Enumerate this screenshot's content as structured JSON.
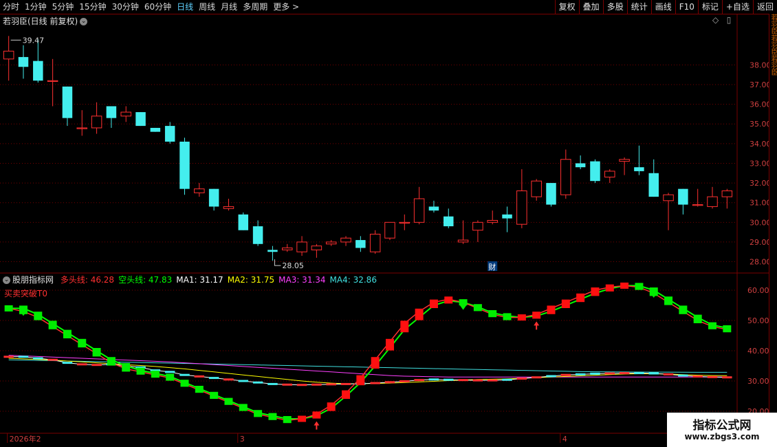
{
  "toolbar": {
    "periods": [
      "分时",
      "1分钟",
      "5分钟",
      "15分钟",
      "30分钟",
      "60分钟",
      "日线",
      "周线",
      "月线",
      "多周期",
      "更多 >"
    ],
    "active_period": "日线",
    "buttons": [
      "复权",
      "叠加",
      "多股",
      "统计",
      "画线",
      "F10",
      "标记",
      "+自选",
      "返回"
    ]
  },
  "stock": {
    "title": "若羽臣(日线 前复权)"
  },
  "price_axis": {
    "ticks": [
      "38.00",
      "37.00",
      "36.00",
      "35.00",
      "34.00",
      "33.00",
      "32.00",
      "31.00",
      "30.00",
      "29.00",
      "28.00"
    ]
  },
  "annotations": {
    "high": "39.47",
    "low": "28.05",
    "finance_marker": "财"
  },
  "indicator": {
    "name": "股朋指标网",
    "legend": [
      {
        "label": "多头线: 46.28",
        "color": "#ff3030"
      },
      {
        "label": "空头线: 47.83",
        "color": "#00ff00"
      },
      {
        "label": "MA1: 31.17",
        "color": "#ffffff"
      },
      {
        "label": "MA2: 31.75",
        "color": "#ffff00"
      },
      {
        "label": "MA3: 31.34",
        "color": "#ff40ff"
      },
      {
        "label": "MA4: 32.86",
        "color": "#40e0e0"
      }
    ],
    "subtitle": "买卖突破T0",
    "axis_ticks": [
      "60.00",
      "50.00",
      "40.00",
      "30.00",
      "20.00"
    ]
  },
  "date_axis": {
    "labels": [
      "2026年2",
      "3",
      "4"
    ]
  },
  "watermark": {
    "line1": "指标公式网",
    "line2": "www.zbgs3.com"
  },
  "side_strip": {
    "text": "若羽臣若羽臣若羽臣"
  },
  "colors": {
    "up": "#ff3030",
    "down": "#44eeee",
    "grid": "#7a0000",
    "axis_text": "#d04040"
  },
  "chart_data": {
    "type": "candlestick",
    "candles": [
      {
        "o": 38.3,
        "h": 39.47,
        "l": 37.2,
        "c": 38.7
      },
      {
        "o": 38.4,
        "h": 39.0,
        "l": 37.3,
        "c": 37.9
      },
      {
        "o": 38.2,
        "h": 39.3,
        "l": 37.1,
        "c": 37.2
      },
      {
        "o": 37.2,
        "h": 38.3,
        "l": 35.9,
        "c": 37.2
      },
      {
        "o": 36.9,
        "h": 36.9,
        "l": 34.9,
        "c": 35.3
      },
      {
        "o": 34.8,
        "h": 35.7,
        "l": 34.4,
        "c": 34.8
      },
      {
        "o": 34.8,
        "h": 36.1,
        "l": 34.5,
        "c": 35.4
      },
      {
        "o": 35.9,
        "h": 35.9,
        "l": 34.8,
        "c": 35.3
      },
      {
        "o": 35.4,
        "h": 35.9,
        "l": 35.1,
        "c": 35.6
      },
      {
        "o": 35.6,
        "h": 35.6,
        "l": 34.9,
        "c": 34.9
      },
      {
        "o": 34.8,
        "h": 34.8,
        "l": 34.6,
        "c": 34.6
      },
      {
        "o": 34.9,
        "h": 35.1,
        "l": 34.0,
        "c": 34.1
      },
      {
        "o": 34.1,
        "h": 34.3,
        "l": 31.4,
        "c": 31.7
      },
      {
        "o": 31.5,
        "h": 32.0,
        "l": 31.3,
        "c": 31.7
      },
      {
        "o": 31.7,
        "h": 31.7,
        "l": 30.6,
        "c": 30.8
      },
      {
        "o": 30.7,
        "h": 31.2,
        "l": 30.6,
        "c": 30.8
      },
      {
        "o": 30.4,
        "h": 30.5,
        "l": 29.6,
        "c": 29.6
      },
      {
        "o": 29.8,
        "h": 30.1,
        "l": 28.8,
        "c": 28.9
      },
      {
        "o": 28.6,
        "h": 28.8,
        "l": 28.05,
        "c": 28.5
      },
      {
        "o": 28.6,
        "h": 28.9,
        "l": 28.5,
        "c": 28.7
      },
      {
        "o": 28.5,
        "h": 29.3,
        "l": 28.3,
        "c": 29.0
      },
      {
        "o": 28.6,
        "h": 28.9,
        "l": 28.2,
        "c": 28.8
      },
      {
        "o": 28.9,
        "h": 29.1,
        "l": 28.8,
        "c": 29.0
      },
      {
        "o": 29.0,
        "h": 29.3,
        "l": 28.8,
        "c": 29.2
      },
      {
        "o": 29.1,
        "h": 29.3,
        "l": 28.5,
        "c": 28.7
      },
      {
        "o": 28.5,
        "h": 29.6,
        "l": 28.4,
        "c": 29.4
      },
      {
        "o": 29.2,
        "h": 30.0,
        "l": 29.1,
        "c": 30.0
      },
      {
        "o": 30.0,
        "h": 30.4,
        "l": 29.6,
        "c": 30.0
      },
      {
        "o": 30.0,
        "h": 31.8,
        "l": 29.9,
        "c": 31.2
      },
      {
        "o": 30.8,
        "h": 31.1,
        "l": 30.5,
        "c": 30.6
      },
      {
        "o": 30.3,
        "h": 30.7,
        "l": 29.7,
        "c": 29.8
      },
      {
        "o": 29.0,
        "h": 30.1,
        "l": 28.9,
        "c": 29.1
      },
      {
        "o": 29.6,
        "h": 30.1,
        "l": 29.0,
        "c": 30.0
      },
      {
        "o": 30.0,
        "h": 30.6,
        "l": 29.9,
        "c": 30.1
      },
      {
        "o": 30.4,
        "h": 30.8,
        "l": 29.5,
        "c": 30.2
      },
      {
        "o": 29.9,
        "h": 32.7,
        "l": 29.7,
        "c": 31.6
      },
      {
        "o": 31.3,
        "h": 32.2,
        "l": 31.1,
        "c": 32.1
      },
      {
        "o": 32.0,
        "h": 32.0,
        "l": 30.8,
        "c": 30.9
      },
      {
        "o": 31.4,
        "h": 33.7,
        "l": 31.2,
        "c": 33.2
      },
      {
        "o": 33.0,
        "h": 33.4,
        "l": 32.7,
        "c": 32.8
      },
      {
        "o": 33.1,
        "h": 33.2,
        "l": 32.0,
        "c": 32.1
      },
      {
        "o": 32.3,
        "h": 32.7,
        "l": 32.0,
        "c": 32.6
      },
      {
        "o": 33.1,
        "h": 33.3,
        "l": 32.4,
        "c": 33.2
      },
      {
        "o": 32.8,
        "h": 33.9,
        "l": 32.4,
        "c": 32.6
      },
      {
        "o": 32.5,
        "h": 33.2,
        "l": 31.3,
        "c": 31.3
      },
      {
        "o": 31.1,
        "h": 31.5,
        "l": 29.6,
        "c": 31.4
      },
      {
        "o": 31.7,
        "h": 31.7,
        "l": 30.4,
        "c": 30.9
      },
      {
        "o": 30.9,
        "h": 31.7,
        "l": 30.8,
        "c": 30.9
      },
      {
        "o": 30.8,
        "h": 31.8,
        "l": 30.7,
        "c": 31.3
      },
      {
        "o": 31.3,
        "h": 31.7,
        "l": 30.7,
        "c": 31.6
      }
    ],
    "price_range": [
      27.6,
      39.9
    ],
    "indicator": {
      "range": [
        15,
        65
      ],
      "long_line": [
        54,
        53,
        51,
        48,
        45,
        42,
        39,
        36,
        34,
        33,
        32,
        31,
        29,
        27,
        25,
        23,
        21,
        19,
        18,
        17,
        17.5,
        19,
        22,
        26,
        31,
        37,
        43,
        49,
        53,
        56,
        57,
        56,
        54,
        52,
        51,
        51,
        52,
        54,
        56,
        58,
        60,
        61,
        61.5,
        61,
        59,
        56,
        53,
        50,
        48,
        47
      ],
      "short_line": [
        54,
        54,
        52,
        49,
        46,
        43,
        40,
        37,
        35,
        33.5,
        32.5,
        31.5,
        29.5,
        27.5,
        25.5,
        23.5,
        21.5,
        19.5,
        18.5,
        17.5,
        17.5,
        18.5,
        21,
        25,
        29.5,
        35,
        41,
        47,
        51,
        55,
        56.5,
        56,
        54.5,
        52.5,
        51.5,
        51,
        51.5,
        53,
        55,
        57,
        59,
        60.5,
        61.5,
        61.5,
        60,
        57,
        54,
        51,
        48.5,
        47.5
      ],
      "ma1": [
        38,
        38,
        37.5,
        37,
        36,
        35.5,
        35.3,
        35.5,
        35,
        34.5,
        33.5,
        33,
        32,
        31.5,
        31,
        30.5,
        30,
        29.5,
        29,
        28.8,
        28.7,
        28.8,
        28.9,
        29,
        29.1,
        29.3,
        29.6,
        29.9,
        30.3,
        30.5,
        30.4,
        30.3,
        30.2,
        30.2,
        30.4,
        30.8,
        31.2,
        31.6,
        32,
        32.2,
        32.4,
        32.5,
        32.6,
        32.6,
        32.5,
        32.2,
        31.8,
        31.5,
        31.3,
        31.2
      ],
      "ma2": [
        37.5,
        37.3,
        37.1,
        36.9,
        36.6,
        36.3,
        36,
        35.7,
        35.4,
        35.1,
        34.8,
        34.4,
        34,
        33.5,
        33,
        32.5,
        32,
        31.5,
        31,
        30.5,
        30,
        29.6,
        29.3,
        29.1,
        29.1,
        29.2,
        29.3,
        29.5,
        29.7,
        29.9,
        30.1,
        30.3,
        30.5,
        30.6,
        30.7,
        30.9,
        31.1,
        31.3,
        31.5,
        31.7,
        31.9,
        32.1,
        32.3,
        32.4,
        32.4,
        32.3,
        32.1,
        31.9,
        31.8,
        31.75
      ],
      "ma3": [
        38.5,
        38.3,
        38.1,
        37.9,
        37.7,
        37.5,
        37.3,
        37.1,
        36.9,
        36.7,
        36.5,
        36.3,
        36,
        35.7,
        35.4,
        35.1,
        34.8,
        34.5,
        34.2,
        33.9,
        33.6,
        33.3,
        33,
        32.7,
        32.4,
        32.1,
        31.8,
        31.6,
        31.5,
        31.4,
        31.3,
        31.3,
        31.3,
        31.3,
        31.3,
        31.3,
        31.3,
        31.3,
        31.3,
        31.3,
        31.3,
        31.3,
        31.3,
        31.3,
        31.3,
        31.3,
        31.3,
        31.3,
        31.34,
        31.34
      ],
      "ma4": [
        37,
        36.9,
        36.8,
        36.7,
        36.6,
        36.5,
        36.4,
        36.3,
        36.2,
        36.1,
        36,
        35.9,
        35.8,
        35.7,
        35.6,
        35.5,
        35.4,
        35.3,
        35.2,
        35.1,
        35,
        34.9,
        34.8,
        34.7,
        34.6,
        34.5,
        34.4,
        34.3,
        34.2,
        34.1,
        34,
        33.9,
        33.8,
        33.7,
        33.6,
        33.5,
        33.4,
        33.3,
        33.2,
        33.1,
        33.05,
        33,
        32.98,
        32.96,
        32.94,
        32.92,
        32.9,
        32.88,
        32.87,
        32.86
      ]
    }
  }
}
